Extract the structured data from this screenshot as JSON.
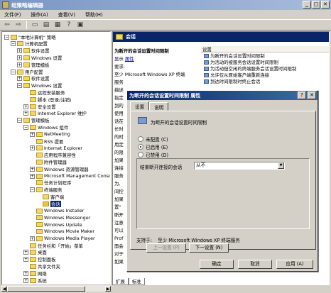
{
  "window": {
    "title": "组策略编辑器"
  },
  "menu": [
    "文件(F)",
    "操作(A)",
    "查看(V)",
    "帮助(H)"
  ],
  "toolbar": {
    "icons": [
      "back-arrow",
      "forward-arrow",
      "up-folder",
      "show-hide-tree",
      "properties",
      "help",
      "export-list"
    ]
  },
  "tree": {
    "rows": [
      {
        "label": "\"本地计算机\" 策略",
        "indent": 0,
        "exp": "-"
      },
      {
        "label": "计算机配置",
        "indent": 1,
        "exp": "-"
      },
      {
        "label": "软件设置",
        "indent": 2,
        "exp": "+"
      },
      {
        "label": "Windows 设置",
        "indent": 2,
        "exp": "+"
      },
      {
        "label": "管理模板",
        "indent": 2,
        "exp": "+"
      },
      {
        "label": "用户配置",
        "indent": 1,
        "exp": "-"
      },
      {
        "label": "软件设置",
        "indent": 2,
        "exp": "+"
      },
      {
        "label": "Windows 设置",
        "indent": 2,
        "exp": "-"
      },
      {
        "label": "远程安装服务",
        "indent": 3,
        "exp": ""
      },
      {
        "label": "脚本 (登录/注销)",
        "indent": 3,
        "exp": ""
      },
      {
        "label": "安全设置",
        "indent": 3,
        "exp": "+"
      },
      {
        "label": "Internet Explorer 维护",
        "indent": 3,
        "exp": "+"
      },
      {
        "label": "管理模板",
        "indent": 2,
        "exp": "-"
      },
      {
        "label": "Windows 组件",
        "indent": 3,
        "exp": "-"
      },
      {
        "label": "NetMeeting",
        "indent": 4,
        "exp": "+"
      },
      {
        "label": "RSS 提要",
        "indent": 4,
        "exp": ""
      },
      {
        "label": "Internet Explorer",
        "indent": 4,
        "exp": "+"
      },
      {
        "label": "应用程序兼容性",
        "indent": 4,
        "exp": ""
      },
      {
        "label": "附件管理器",
        "indent": 4,
        "exp": ""
      },
      {
        "label": "Windows 资源管理器",
        "indent": 4,
        "exp": "+"
      },
      {
        "label": "Microsoft Management Conso",
        "indent": 4,
        "exp": "+"
      },
      {
        "label": "任务计划程序",
        "indent": 4,
        "exp": ""
      },
      {
        "label": "终端服务",
        "indent": 4,
        "exp": "-"
      },
      {
        "label": "客户端",
        "indent": 5,
        "exp": ""
      },
      {
        "label": "会话",
        "indent": 5,
        "exp": "",
        "selected": true
      },
      {
        "label": "Windows Installer",
        "indent": 4,
        "exp": ""
      },
      {
        "label": "Windows Messenger",
        "indent": 4,
        "exp": ""
      },
      {
        "label": "Windows Update",
        "indent": 4,
        "exp": ""
      },
      {
        "label": "Windows Movie Maker",
        "indent": 4,
        "exp": ""
      },
      {
        "label": "Windows Media Player",
        "indent": 4,
        "exp": "+"
      },
      {
        "label": "任务栏和「开始」菜单",
        "indent": 3,
        "exp": ""
      },
      {
        "label": "桌面",
        "indent": 3,
        "exp": "+"
      },
      {
        "label": "控制面板",
        "indent": 3,
        "exp": "+"
      },
      {
        "label": "共享文件夹",
        "indent": 3,
        "exp": ""
      },
      {
        "label": "网络",
        "indent": 3,
        "exp": "+"
      },
      {
        "label": "系统",
        "indent": 3,
        "exp": "+"
      }
    ]
  },
  "right_pane": {
    "header": "会话",
    "policy_title": "为断开的会话设置时间限制",
    "display_label": "显示",
    "properties_link": "属性",
    "desc_lines": [
      "要求:",
      "至少 Microsoft Windows XP 终端",
      "服务",
      "描述",
      "指定",
      "到的",
      "使用",
      "话在",
      "长时",
      "的时",
      "用定",
      "的限",
      "加果",
      "连接",
      "服务",
      "为,",
      "间控",
      "加果",
      "置\"",
      "断开",
      "注意",
      "可以",
      "Prof",
      "面会",
      "对于",
      "如果"
    ],
    "list_header": "设置",
    "settings": [
      "为断开的会话设置时间限制",
      "为活动的被服务会话设置时间限制",
      "为活动但空闲的终端服务会话设置时间限制",
      "允许仅从原始客户端重新连接",
      "到达时间限制时终止会话"
    ],
    "bottom_tabs": [
      "扩展",
      "标准"
    ]
  },
  "dialog": {
    "title": "为断开的会话设置时间限制 属性",
    "tabs": [
      "设置",
      "说明"
    ],
    "policy_name": "为断开的会话设置时间限制",
    "radios": [
      "未配置 (C)",
      "已启用 (E)",
      "已禁用 (D)"
    ],
    "selected_radio": 1,
    "combo_label": "结束断开连接的会话",
    "combo_value": "从不",
    "support_label": "支持于:",
    "support_value": "至少 Microsoft Windows XP 终端服务",
    "prev_button": "上一设置 (P)",
    "next_button": "下一设置 (N)",
    "ok_button": "确定",
    "cancel_button": "取消",
    "apply_button": "应用 (A)"
  }
}
